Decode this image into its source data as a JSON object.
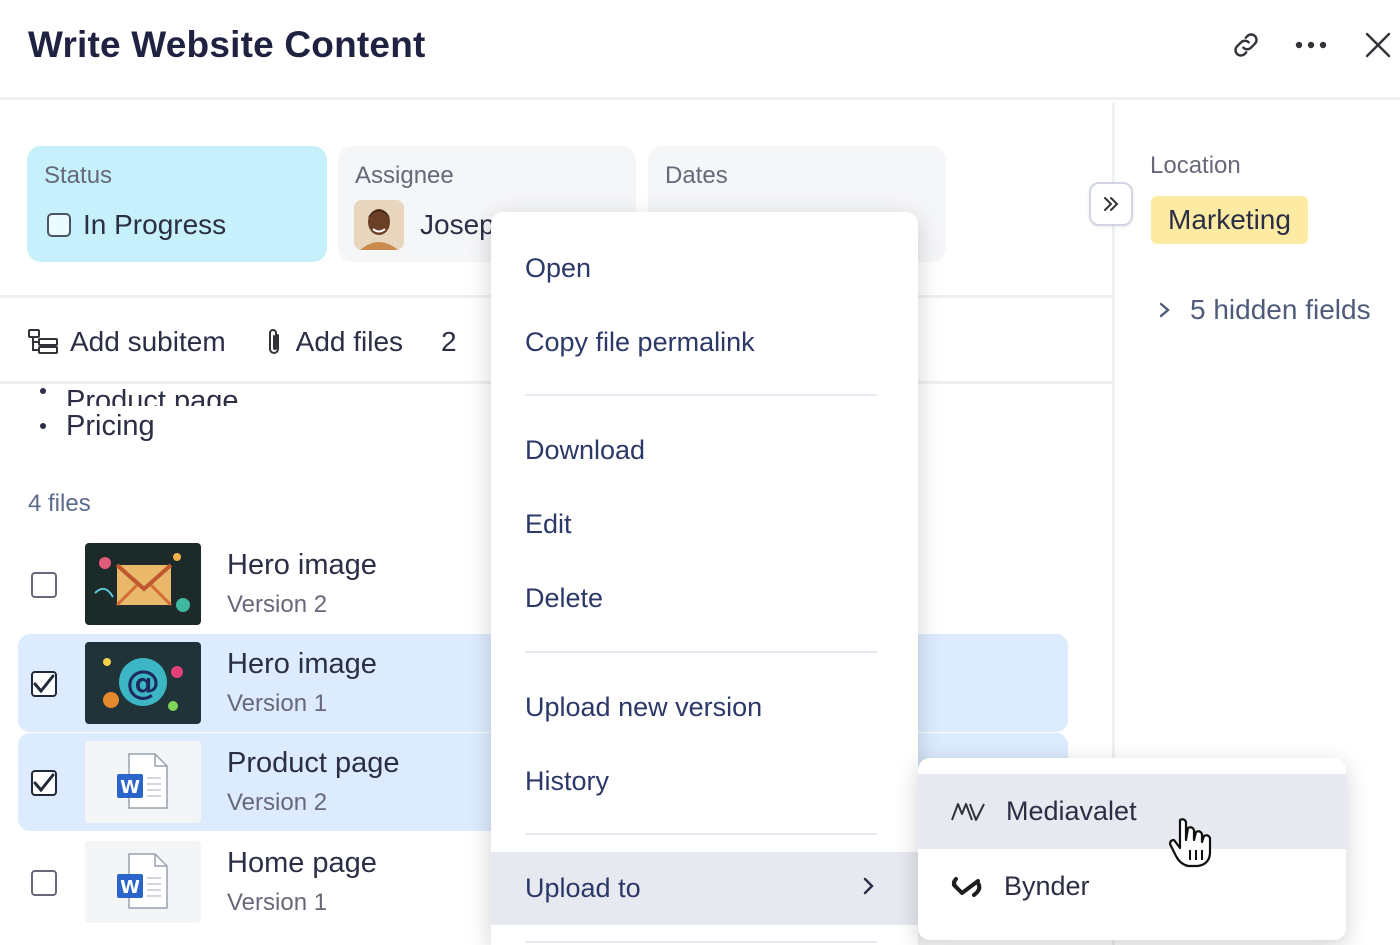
{
  "header": {
    "title": "Write Website Content",
    "icons": [
      "link-icon",
      "more-icon",
      "close-icon"
    ]
  },
  "properties": {
    "status": {
      "label": "Status",
      "value": "In Progress"
    },
    "assignee": {
      "label": "Assignee",
      "value": "Josep"
    },
    "dates": {
      "label": "Dates",
      "value": ""
    }
  },
  "toolbar": {
    "add_subitem": "Add subitem",
    "add_files": "Add files",
    "extra": "2"
  },
  "description": {
    "bullets": [
      "Product page",
      "Pricing"
    ]
  },
  "files": {
    "count_label": "4 files",
    "items": [
      {
        "name": "Hero image",
        "version": "Version 2",
        "checked": false,
        "selected": false,
        "thumb": "envelope-image"
      },
      {
        "name": "Hero image",
        "version": "Version 1",
        "checked": true,
        "selected": true,
        "thumb": "at-sign-image"
      },
      {
        "name": "Product page",
        "version": "Version 2",
        "checked": true,
        "selected": true,
        "thumb": "word-doc"
      },
      {
        "name": "Home page",
        "version": "Version 1",
        "checked": false,
        "selected": false,
        "thumb": "word-doc"
      }
    ]
  },
  "side_panel": {
    "location_label": "Location",
    "location_value": "Marketing",
    "hidden_fields": "5 hidden fields"
  },
  "context_menu": {
    "items": [
      "Open",
      "Copy file permalink",
      "Download",
      "Edit",
      "Delete",
      "Upload new version",
      "History",
      "Upload to"
    ],
    "highlighted": "Upload to"
  },
  "submenu": {
    "items": [
      "Mediavalet",
      "Bynder"
    ],
    "highlighted": "Mediavalet"
  },
  "colors": {
    "status_bg": "#c6f0fb",
    "selected_row_bg": "#dcebfe",
    "location_tag_bg": "#fdeaa3",
    "menu_text": "#2b3868"
  }
}
